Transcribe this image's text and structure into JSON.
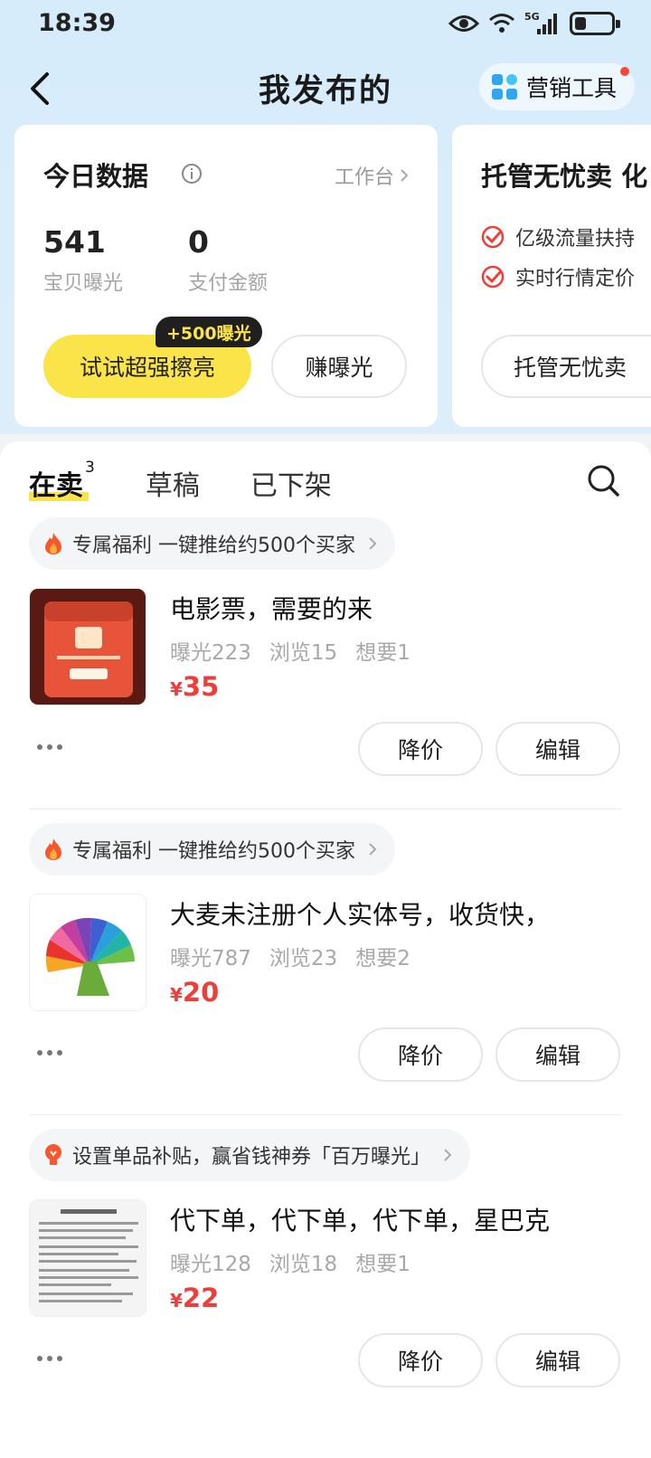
{
  "status_bar": {
    "time": "18:39",
    "network": "5G"
  },
  "nav": {
    "title": "我发布的",
    "marketing_label": "营销工具"
  },
  "today": {
    "title": "今日数据",
    "workbench": "工作台",
    "exposure_value": "541",
    "exposure_label": "宝贝曝光",
    "pay_value": "0",
    "pay_label": "支付金额",
    "shine_button": "试试超强擦亮",
    "bonus_badge": "+500曝光",
    "earn_button": "赚曝光"
  },
  "managed": {
    "title": "托管无忧卖 化",
    "feature1": "亿级流量扶持",
    "feature2": "实时行情定价",
    "button": "托管无忧卖"
  },
  "tabs": {
    "on_sale": "在卖",
    "on_sale_count": "3",
    "drafts": "草稿",
    "removed": "已下架"
  },
  "items": [
    {
      "promo": "专属福利 一键推给约500个买家",
      "title": "电影票，需要的来",
      "exposure": "曝光223",
      "views": "浏览15",
      "wants": "想要1",
      "currency": "¥",
      "price": "35",
      "reduce": "降价",
      "edit": "编辑"
    },
    {
      "promo": "专属福利 一键推给约500个买家",
      "title": "大麦未注册个人实体号，收货快，",
      "exposure": "曝光787",
      "views": "浏览23",
      "wants": "想要2",
      "currency": "¥",
      "price": "20",
      "reduce": "降价",
      "edit": "编辑"
    },
    {
      "promo": "设置单品补贴，赢省钱神券「百万曝光」",
      "title": "代下单，代下单，代下单，星巴克",
      "exposure": "曝光128",
      "views": "浏览18",
      "wants": "想要1",
      "currency": "¥",
      "price": "22",
      "reduce": "降价",
      "edit": "编辑"
    }
  ],
  "colors": {
    "accent_yellow": "#fbe449",
    "price_red": "#ef3e3a",
    "background_blue": "#d6ecfb"
  }
}
